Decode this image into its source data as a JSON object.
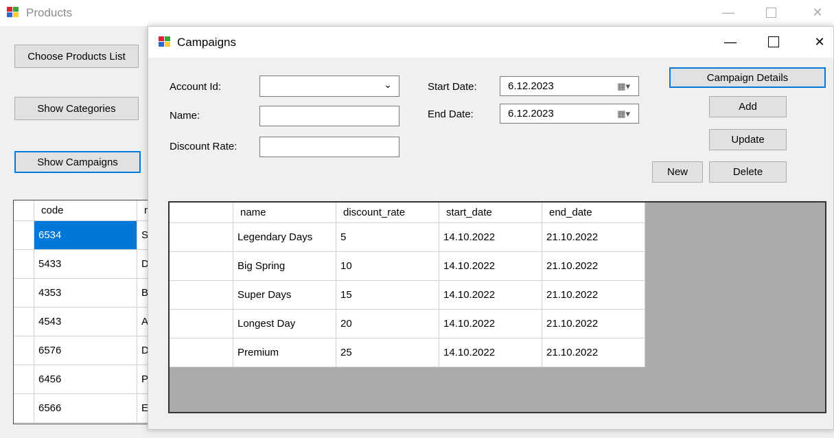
{
  "products_window": {
    "title": "Products",
    "buttons": {
      "choose_products_list": "Choose Products List",
      "show_categories": "Show Categories",
      "show_campaigns": "Show Campaigns"
    },
    "grid": {
      "columns": [
        "code",
        "n"
      ],
      "rows": [
        {
          "code": "6534",
          "name": "S"
        },
        {
          "code": "5433",
          "name": "D"
        },
        {
          "code": "4353",
          "name": "B"
        },
        {
          "code": "4543",
          "name": "A"
        },
        {
          "code": "6576",
          "name": "D"
        },
        {
          "code": "6456",
          "name": "P"
        },
        {
          "code": "6566",
          "name": "E"
        }
      ]
    }
  },
  "campaigns_window": {
    "title": "Campaigns",
    "labels": {
      "account_id": "Account Id:",
      "name": "Name:",
      "discount_rate": "Discount Rate:",
      "start_date": "Start Date:",
      "end_date": "End Date:"
    },
    "fields": {
      "account_id": "",
      "name": "",
      "discount_rate": "",
      "start_date": "6.12.2023",
      "end_date": "6.12.2023"
    },
    "buttons": {
      "campaign_details": "Campaign Details",
      "add": "Add",
      "update": "Update",
      "new": "New",
      "delete": "Delete"
    },
    "grid": {
      "columns": [
        "name",
        "discount_rate",
        "start_date",
        "end_date"
      ],
      "rows": [
        [
          "Legendary Days",
          "5",
          "14.10.2022",
          "21.10.2022"
        ],
        [
          "Big Spring",
          "10",
          "14.10.2022",
          "21.10.2022"
        ],
        [
          "Super Days",
          "15",
          "14.10.2022",
          "21.10.2022"
        ],
        [
          "Longest Day",
          "20",
          "14.10.2022",
          "21.10.2022"
        ],
        [
          "Premium",
          "25",
          "14.10.2022",
          "21.10.2022"
        ]
      ]
    }
  },
  "colors": {
    "accent": "#0078d7",
    "grid_background": "#ababab",
    "window_background": "#f0f0f0"
  }
}
